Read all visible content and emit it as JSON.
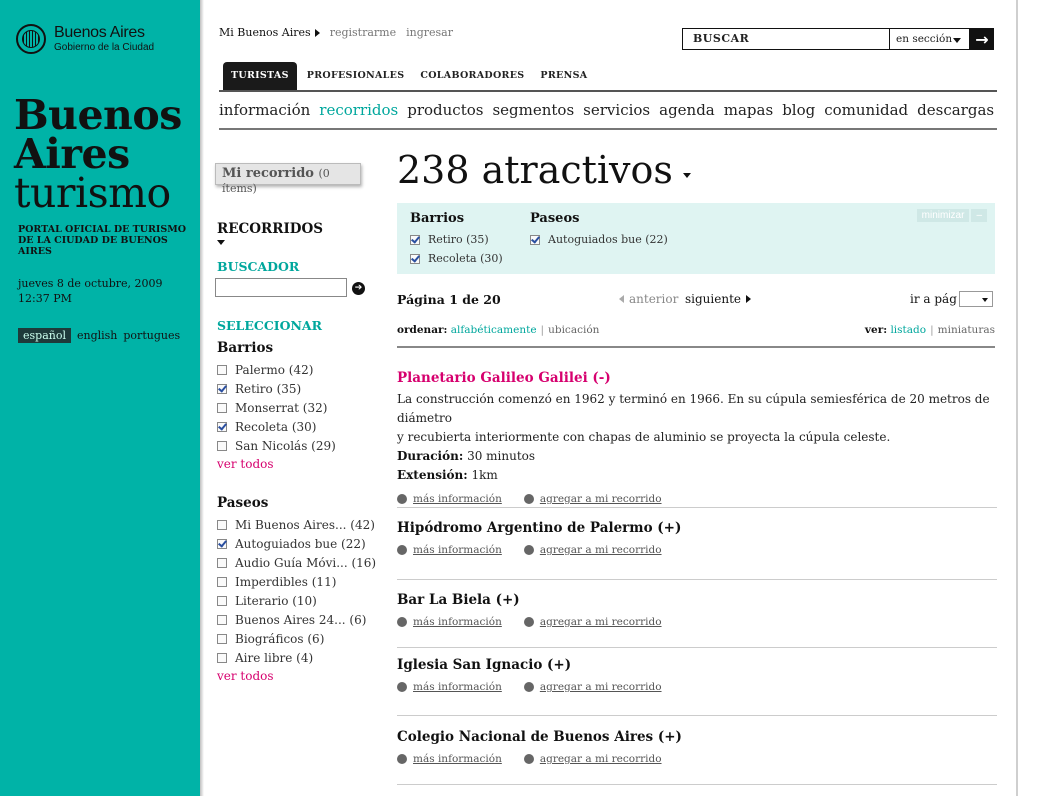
{
  "brand": {
    "logo_name": "Buenos Aires",
    "logo_sub": "Gobierno de la Ciudad",
    "title_line1": "Buenos",
    "title_line2": "Aires",
    "title_line3": "turismo",
    "portal": "PORTAL OFICIAL DE TURISMO DE LA CIUDAD DE BUENOS AIRES",
    "date": "jueves 8 de octubre, 2009",
    "time": "12:37 PM",
    "languages": [
      "español",
      "english",
      "portugues"
    ]
  },
  "topnav": {
    "mi_buenos_aires": "Mi Buenos Aires",
    "registrarme": "registrarme",
    "ingresar": "ingresar"
  },
  "search": {
    "placeholder": "BUSCAR",
    "scope": "en sección",
    "go_icon": "arrow-right-icon"
  },
  "tabs": [
    "TURISTAS",
    "PROFESIONALES",
    "COLABORADORES",
    "PRENSA"
  ],
  "subnav": [
    "información",
    "recorridos",
    "productos",
    "segmentos",
    "servicios",
    "agenda",
    "mapas",
    "blog",
    "comunidad",
    "descargas"
  ],
  "sidebar": {
    "mi_recorrido": "Mi recorrido",
    "mi_recorrido_count": "(0 ítems)",
    "recorridos": "RECORRIDOS",
    "buscador": "BUSCADOR",
    "seleccionar": "SELECCIONAR",
    "barrios": {
      "title": "Barrios",
      "items": [
        {
          "label": "Palermo (42)",
          "checked": false
        },
        {
          "label": "Retiro (35)",
          "checked": true
        },
        {
          "label": "Monserrat (32)",
          "checked": false
        },
        {
          "label": "Recoleta (30)",
          "checked": true
        },
        {
          "label": "San Nicolás (29)",
          "checked": false
        }
      ],
      "ver_todos": "ver todos"
    },
    "paseos": {
      "title": "Paseos",
      "items": [
        {
          "label": "Mi Buenos Aires... (42)",
          "checked": false
        },
        {
          "label": "Autoguiados bue (22)",
          "checked": true
        },
        {
          "label": "Audio Guía Móvi... (16)",
          "checked": false
        },
        {
          "label": "Imperdibles (11)",
          "checked": false
        },
        {
          "label": "Literario (10)",
          "checked": false
        },
        {
          "label": "Buenos Aires 24... (6)",
          "checked": false
        },
        {
          "label": "Biográficos (6)",
          "checked": false
        },
        {
          "label": "Aire libre (4)",
          "checked": false
        }
      ],
      "ver_todos": "ver todos"
    }
  },
  "main": {
    "title": "238 atractivos",
    "filters": {
      "barrios_title": "Barrios",
      "barrios": [
        "Retiro (35)",
        "Recoleta (30)"
      ],
      "paseos_title": "Paseos",
      "paseos": [
        "Autoguiados bue (22)"
      ],
      "minimizar": "minimizar",
      "minimizar_btn": "–"
    },
    "pager": {
      "page": "Página 1 de 20",
      "prev": "anterior",
      "next": "siguiente",
      "goto": "ir a pág"
    },
    "sort": {
      "ordenar": "ordenar:",
      "alfabeticamente": "alfabéticamente",
      "ubicacion": "ubicación",
      "ver": "ver:",
      "listado": "listado",
      "miniaturas": "miniaturas",
      "sep": "|"
    },
    "results": [
      {
        "title": "Planetario Galileo Galilei (-)",
        "desc1": "La construcción comenzó en 1962 y terminó en 1966. En su cúpula semiesférica de 20 metros de diámetro",
        "desc2": "y recubierta interiormente con chapas de aluminio se proyecta la cúpula celeste.",
        "duracion_label": "Duración:",
        "duracion": "30 minutos",
        "extension_label": "Extensión:",
        "extension": "1km"
      },
      {
        "title": "Hipódromo Argentino de Palermo (+)"
      },
      {
        "title": "Bar La Biela (+)"
      },
      {
        "title": "Iglesia San Ignacio (+)"
      },
      {
        "title": "Colegio Nacional de Buenos Aires (+)"
      }
    ],
    "actions": {
      "mas_info": "más información",
      "agregar": "agregar a mi recorrido"
    }
  }
}
